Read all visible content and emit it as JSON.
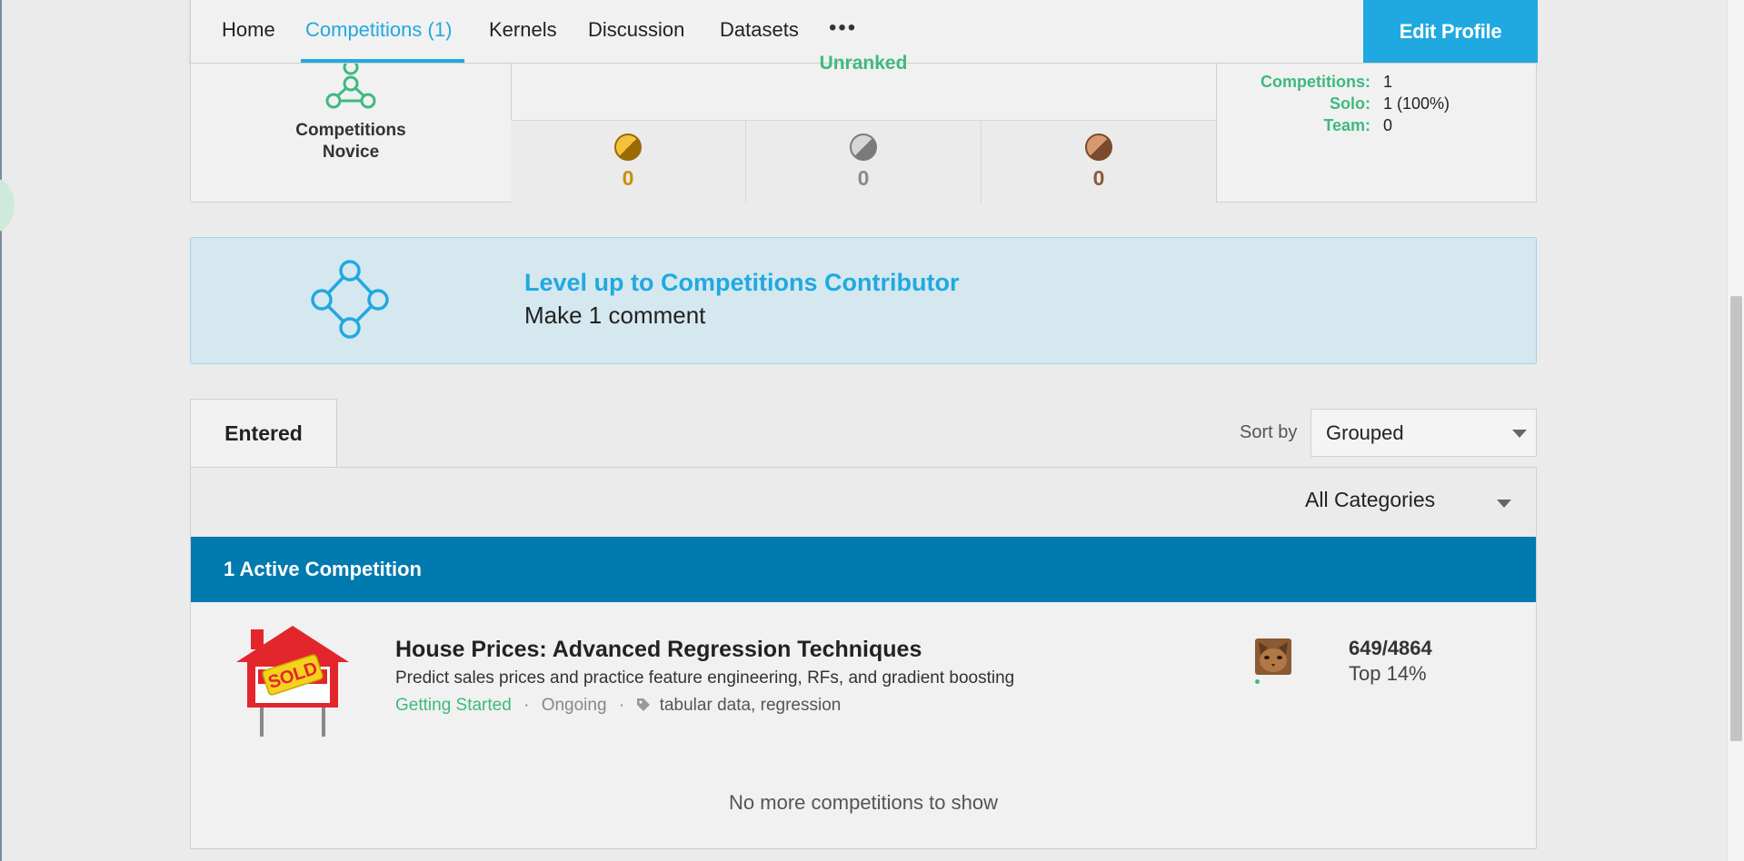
{
  "nav": {
    "tabs": [
      "Home",
      "Competitions (1)",
      "Kernels",
      "Discussion",
      "Datasets"
    ],
    "active_tab": "Competitions (1)",
    "more_label": "•••",
    "edit_profile_label": "Edit Profile"
  },
  "tier": {
    "label_line1": "Competitions",
    "label_line2": "Novice",
    "icon": "novice-tier-icon"
  },
  "ranking": {
    "status": "Unranked",
    "gold_count": "0",
    "silver_count": "0",
    "bronze_count": "0"
  },
  "summary": {
    "competitions_label": "Competitions:",
    "competitions_value": "1",
    "solo_label": "Solo:",
    "solo_value": "1 (100%)",
    "team_label": "Team:",
    "team_value": "0"
  },
  "levelup": {
    "title": "Level up to Competitions Contributor",
    "subtitle": "Make 1 comment",
    "icon": "contributor-tier-icon"
  },
  "tabs": {
    "entered_label": "Entered",
    "sort_label": "Sort by",
    "sort_value": "Grouped",
    "category_value": "All Categories"
  },
  "competitions": {
    "header": "1 Active Competition",
    "items": [
      {
        "title": "House Prices: Advanced Regression Techniques",
        "description": "Predict sales prices and practice feature engineering, RFs, and gradient boosting",
        "category": "Getting Started",
        "status": "Ongoing",
        "tags": "tabular data, regression",
        "rank": "649/4864",
        "percentile": "Top 14%",
        "thumb_text": "SOLD"
      }
    ],
    "empty_message": "No more competitions to show"
  },
  "colors": {
    "accent": "#20a9e0",
    "green": "#3dba7d",
    "header_blue": "#017aaf",
    "gold": "#c9900a",
    "silver": "#8a8a8a",
    "bronze": "#8b5a3c"
  }
}
